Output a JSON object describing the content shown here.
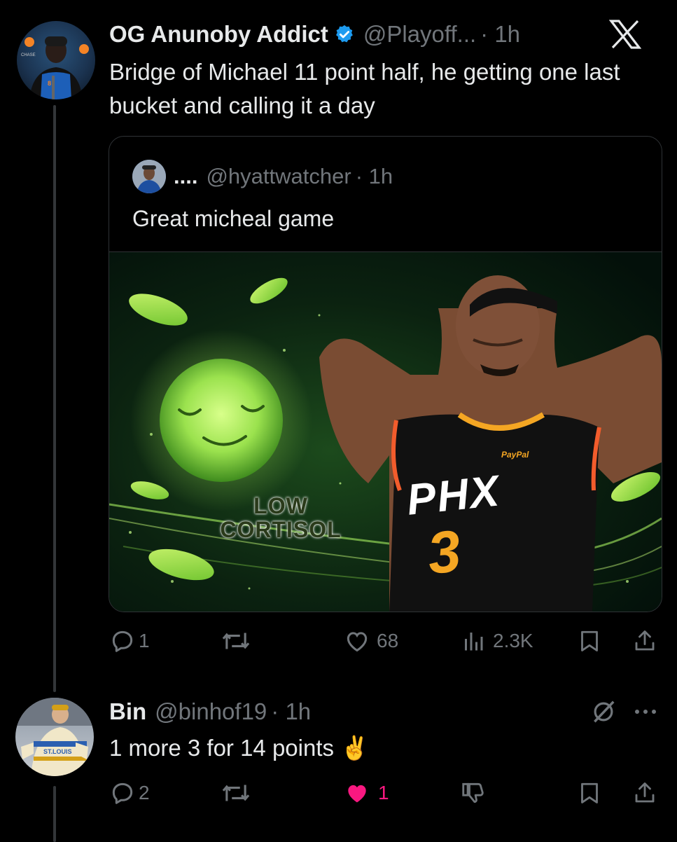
{
  "tweet1": {
    "author_name": "OG Anunoby Addict",
    "handle": "@Playoff...",
    "time": "· 1h",
    "text": "Bridge of Michael 11 point half, he getting one last bucket and calling it a day",
    "quote": {
      "author_name": "....",
      "handle": "@hyattwatcher",
      "time": "· 1h",
      "text": "Great micheal game",
      "media": {
        "line1": "LOW",
        "line2": "CORTISOL",
        "jersey_team": "PHX",
        "jersey_number": "3",
        "jersey_sponsor": "PayPal"
      }
    },
    "actions": {
      "replies": "1",
      "likes": "68",
      "views": "2.3K"
    }
  },
  "tweet2": {
    "author_name": "Bin",
    "handle": "@binhof19",
    "time": "· 1h",
    "text": "1 more 3 for 14 points ✌️",
    "jersey_text": "ST.LOUIS",
    "actions": {
      "replies": "2",
      "likes": "1"
    }
  },
  "colors": {
    "background": "#000000",
    "text": "#e7e9ea",
    "muted": "#71767b",
    "verified": "#1d9bf0",
    "like_active": "#f91880",
    "accent_green": "#7be34a"
  },
  "icons": [
    "x-logo-icon",
    "verified-badge-icon",
    "reply-icon",
    "repost-icon",
    "like-icon",
    "views-icon",
    "bookmark-icon",
    "share-icon",
    "grok-icon",
    "more-icon",
    "dislike-icon"
  ]
}
